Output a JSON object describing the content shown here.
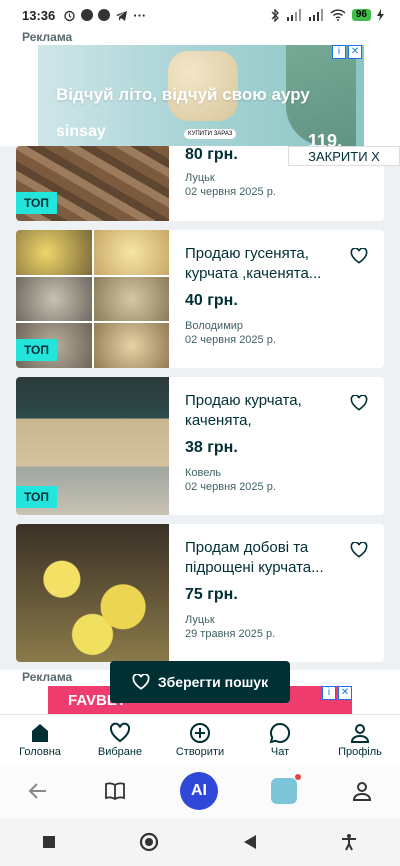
{
  "status_bar": {
    "time": "13:36",
    "battery": "96"
  },
  "ad_top": {
    "label": "Реклама",
    "headline": "Відчуй літо, відчуй свою ауру",
    "brand": "sinsay",
    "cta": "КУПИТИ ЗАРАЗ",
    "price": "119.",
    "close_label": "ЗАКРИТИ X"
  },
  "listings": [
    {
      "title": "",
      "price": "80 грн.",
      "location": "Луцьк",
      "date": "02 червня 2025 р.",
      "badge": "ТОП"
    },
    {
      "title": "Продаю гусенята, курчата ,каченята...",
      "price": "40 грн.",
      "location": "Володимир",
      "date": "02 червня 2025 р.",
      "badge": "ТОП"
    },
    {
      "title": "Продаю курчата, каченята, гусинята,...",
      "price": "38 грн.",
      "location": "Ковель",
      "date": "02 червня 2025 р.",
      "badge": "ТОП"
    },
    {
      "title": "Продам добові та підрощені курчата...",
      "price": "75 грн.",
      "location": "Луцьк",
      "date": "29 травня 2025 р.",
      "badge": ""
    }
  ],
  "ad_bottom": {
    "label": "Реклама",
    "brand": "FAVBET"
  },
  "save_search": {
    "label": "Зберегти пошук"
  },
  "bottom_nav": [
    {
      "label": "Головна",
      "icon": "home-icon"
    },
    {
      "label": "Вибране",
      "icon": "heart-icon"
    },
    {
      "label": "Створити",
      "icon": "plus-circle-icon"
    },
    {
      "label": "Чат",
      "icon": "chat-icon"
    },
    {
      "label": "Профіль",
      "icon": "profile-icon"
    }
  ],
  "browser_bar": {
    "ai_label": "AI"
  }
}
